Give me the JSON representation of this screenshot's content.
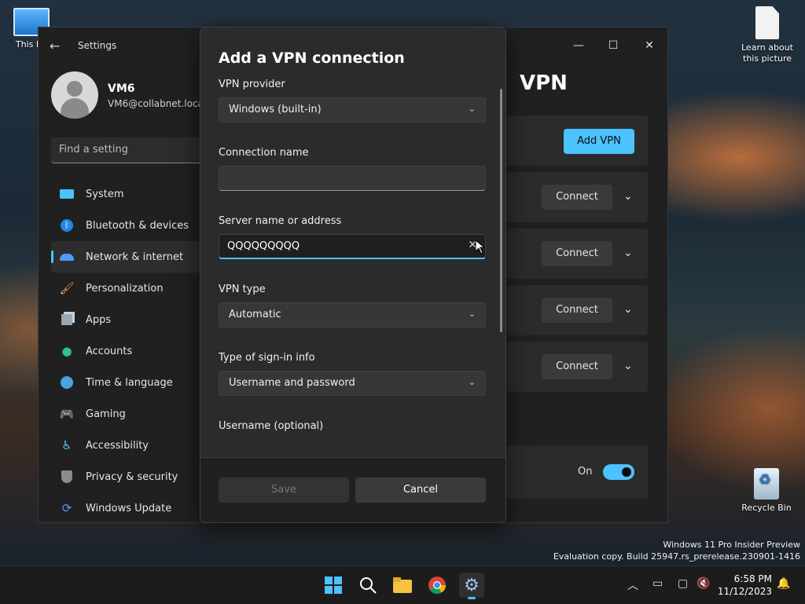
{
  "desktop": {
    "icons": [
      {
        "label": "This PC"
      },
      {
        "label": "Learn about this picture"
      },
      {
        "label": "Recycle Bin"
      }
    ],
    "watermark": {
      "line1": "Windows 11 Pro Insider Preview",
      "line2": "Evaluation copy. Build 25947.rs_prerelease.230901-1416"
    }
  },
  "settings": {
    "app_title": "Settings",
    "user": {
      "name": "VM6",
      "email": "VM6@collabnet.local"
    },
    "search_placeholder": "Find a setting",
    "nav": [
      {
        "label": "System",
        "icon": "monitor-icon",
        "active": false
      },
      {
        "label": "Bluetooth & devices",
        "icon": "bluetooth-icon",
        "active": false
      },
      {
        "label": "Network & internet",
        "icon": "wifi-icon",
        "active": true
      },
      {
        "label": "Personalization",
        "icon": "brush-icon",
        "active": false
      },
      {
        "label": "Apps",
        "icon": "apps-icon",
        "active": false
      },
      {
        "label": "Accounts",
        "icon": "person-icon",
        "active": false
      },
      {
        "label": "Time & language",
        "icon": "globe-icon",
        "active": false
      },
      {
        "label": "Gaming",
        "icon": "gamepad-icon",
        "active": false
      },
      {
        "label": "Accessibility",
        "icon": "accessibility-icon",
        "active": false
      },
      {
        "label": "Privacy & security",
        "icon": "shield-icon",
        "active": false
      },
      {
        "label": "Windows Update",
        "icon": "update-icon",
        "active": false
      }
    ],
    "page_title": "VPN",
    "add_vpn_label": "Add VPN",
    "connections": [
      {
        "connect_label": "Connect"
      },
      {
        "connect_label": "Connect"
      },
      {
        "connect_label": "Connect"
      },
      {
        "connect_label": "Connect"
      }
    ],
    "toggle": {
      "state_label": "On",
      "on": true
    }
  },
  "dialog": {
    "title": "Add a VPN connection",
    "vpn_provider": {
      "label": "VPN provider",
      "value": "Windows (built-in)"
    },
    "connection_name": {
      "label": "Connection name",
      "value": ""
    },
    "server": {
      "label": "Server name or address",
      "value": "QQQQQQQQQ"
    },
    "vpn_type": {
      "label": "VPN type",
      "value": "Automatic"
    },
    "signin_type": {
      "label": "Type of sign-in info",
      "value": "Username and password"
    },
    "username_label": "Username (optional)",
    "save_label": "Save",
    "cancel_label": "Cancel"
  },
  "taskbar": {
    "time": "6:58 PM",
    "date": "11/12/2023"
  },
  "colors": {
    "accent": "#4cc2ff",
    "window_bg": "#202020",
    "dialog_bg": "#2b2b2b"
  }
}
